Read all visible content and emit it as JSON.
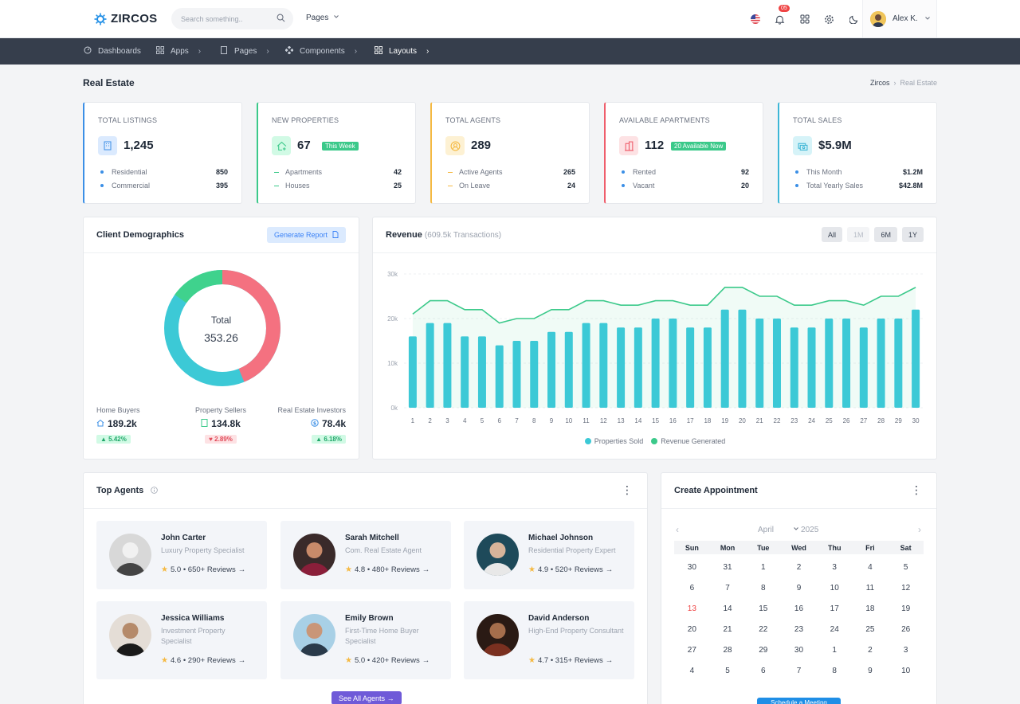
{
  "topbar": {
    "brand": "ZIRCOS",
    "search_placeholder": "Search something..",
    "pages_label": "Pages",
    "notification_count": "05",
    "user_name": "Alex K."
  },
  "nav": {
    "items": [
      {
        "label": "Dashboards",
        "icon": "dashboard-icon"
      },
      {
        "label": "Apps",
        "icon": "apps-icon"
      },
      {
        "label": "Pages",
        "icon": "pages-icon"
      },
      {
        "label": "Components",
        "icon": "components-icon"
      },
      {
        "label": "Layouts",
        "icon": "layouts-icon"
      }
    ]
  },
  "page": {
    "title": "Real Estate",
    "breadcrumb_root": "Zircos",
    "breadcrumb_current": "Real Estate"
  },
  "stats": [
    {
      "title": "Total Listings",
      "value": "1,245",
      "pill": "",
      "color": "#3b8fe6",
      "rows": [
        {
          "label": "Residential",
          "value": "850"
        },
        {
          "label": "Commercial",
          "value": "395"
        }
      ]
    },
    {
      "title": "New Properties",
      "value": "67",
      "pill": "This Week",
      "color": "#3bc98a",
      "rows": [
        {
          "label": "Apartments",
          "value": "42"
        },
        {
          "label": "Houses",
          "value": "25"
        }
      ]
    },
    {
      "title": "Total Agents",
      "value": "289",
      "pill": "",
      "color": "#f5b942",
      "rows": [
        {
          "label": "Active Agents",
          "value": "265"
        },
        {
          "label": "On Leave",
          "value": "24"
        }
      ]
    },
    {
      "title": "Available Apartments",
      "value": "112",
      "pill": "20 Available Now",
      "color": "#ef5e6c",
      "rows": [
        {
          "label": "Rented",
          "value": "92"
        },
        {
          "label": "Vacant",
          "value": "20"
        }
      ]
    },
    {
      "title": "Total Sales",
      "value": "$5.9M",
      "pill": "",
      "color": "#3db6d6",
      "rows": [
        {
          "label": "This Month",
          "value": "$1.2M"
        },
        {
          "label": "Total Yearly Sales",
          "value": "$42.8M"
        }
      ]
    }
  ],
  "demographics": {
    "title": "Client Demographics",
    "button": "Generate Report",
    "total_label": "Total",
    "total_value": "353.26",
    "segments": [
      {
        "name": "Home Buyers",
        "value": "189.2k",
        "change": "5.42%",
        "trend": "up"
      },
      {
        "name": "Property Sellers",
        "value": "134.8k",
        "change": "2.89%",
        "trend": "down"
      },
      {
        "name": "Real Estate Investors",
        "value": "78.4k",
        "change": "6.18%",
        "trend": "up"
      }
    ]
  },
  "revenue": {
    "title": "Revenue",
    "subtitle": "(609.5k Transactions)",
    "ranges": [
      "All",
      "1M",
      "6M",
      "1Y"
    ]
  },
  "chart_data": {
    "type": "bar",
    "x": [
      1,
      2,
      3,
      4,
      5,
      6,
      7,
      8,
      9,
      10,
      11,
      12,
      13,
      14,
      15,
      16,
      17,
      18,
      19,
      20,
      21,
      22,
      23,
      24,
      25,
      26,
      27,
      28,
      29,
      30
    ],
    "ylim": [
      0,
      30000
    ],
    "yticks": [
      "0k",
      "10k",
      "20k",
      "30k"
    ],
    "series": [
      {
        "name": "Properties Sold",
        "type": "bar",
        "color": "#3cc9d6",
        "values": [
          16000,
          19000,
          19000,
          16000,
          16000,
          14000,
          15000,
          15000,
          17000,
          17000,
          19000,
          19000,
          18000,
          18000,
          20000,
          20000,
          18000,
          18000,
          22000,
          22000,
          20000,
          20000,
          18000,
          18000,
          20000,
          20000,
          18000,
          20000,
          20000,
          22000
        ]
      },
      {
        "name": "Revenue Generated",
        "type": "area",
        "color": "#3bc98a",
        "values": [
          21000,
          24000,
          24000,
          22000,
          22000,
          19000,
          20000,
          20000,
          22000,
          22000,
          24000,
          24000,
          23000,
          23000,
          24000,
          24000,
          23000,
          23000,
          27000,
          27000,
          25000,
          25000,
          23000,
          23000,
          24000,
          24000,
          23000,
          25000,
          25000,
          27000
        ]
      }
    ]
  },
  "agents": {
    "title": "Top Agents",
    "see_all": "See All Agents",
    "items": [
      {
        "name": "John Carter",
        "role": "Luxury Property Specialist",
        "rating": "5.0 • 650+ Reviews"
      },
      {
        "name": "Sarah Mitchell",
        "role": "Com. Real Estate Agent",
        "rating": "4.8 • 480+ Reviews"
      },
      {
        "name": "Michael Johnson",
        "role": "Residential Property Expert",
        "rating": "4.9 • 520+ Reviews"
      },
      {
        "name": "Jessica Williams",
        "role": "Investment Property Specialist",
        "rating": "4.6 • 290+ Reviews"
      },
      {
        "name": "Emily Brown",
        "role": "First-Time Home Buyer Specialist",
        "rating": "5.0 • 420+ Reviews"
      },
      {
        "name": "David Anderson",
        "role": "High-End Property Consultant",
        "rating": "4.7 • 315+ Reviews"
      }
    ]
  },
  "calendar": {
    "title": "Create Appointment",
    "month": "April",
    "year": "2025",
    "weekdays": [
      "Sun",
      "Mon",
      "Tue",
      "Wed",
      "Thu",
      "Fri",
      "Sat"
    ],
    "days": [
      "30",
      "31",
      "1",
      "2",
      "3",
      "4",
      "5",
      "6",
      "7",
      "8",
      "9",
      "10",
      "11",
      "12",
      "13",
      "14",
      "15",
      "16",
      "17",
      "18",
      "19",
      "20",
      "21",
      "22",
      "23",
      "24",
      "25",
      "26",
      "27",
      "28",
      "29",
      "30",
      "1",
      "2",
      "3",
      "4",
      "5",
      "6",
      "7",
      "8",
      "9",
      "10"
    ],
    "today_index": 14,
    "button": "Schedule a Meeting"
  }
}
